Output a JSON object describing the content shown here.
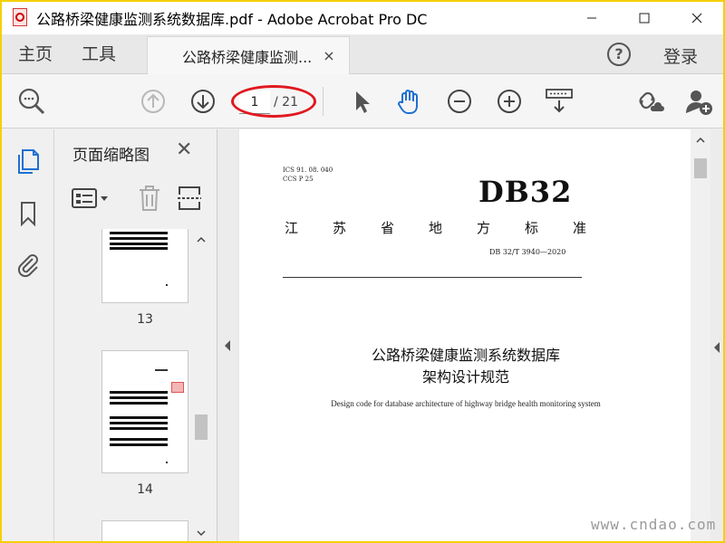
{
  "window": {
    "title": "公路桥梁健康监测系统数据库.pdf - Adobe Acrobat Pro DC"
  },
  "tabs": {
    "home": "主页",
    "tools": "工具",
    "document": "公路桥梁健康监测...",
    "close_glyph": "×",
    "login": "登录",
    "help_glyph": "?"
  },
  "toolbar": {
    "current_page": "1",
    "page_total": "/ 21"
  },
  "panel": {
    "title": "页面缩略图",
    "close_glyph": "✕",
    "thumbnails": [
      {
        "page": "13"
      },
      {
        "page": "14"
      }
    ]
  },
  "document": {
    "ics": "ICS  91. 08. 040",
    "ccs": "CCS  P  25",
    "standard_code": "DB32",
    "province_label": "江苏省地方标准",
    "standard_number": "DB 32/T 3940—2020",
    "title_line1": "公路桥梁健康监测系统数据库",
    "title_line2": "架构设计规范",
    "title_english": "Design code for database architecture of highway bridge health monitoring system"
  },
  "watermark": "www.cndao.com",
  "colors": {
    "highlight_oval": "#e0191e",
    "frame": "#ffd600",
    "accent_blue": "#1f6fd1"
  }
}
